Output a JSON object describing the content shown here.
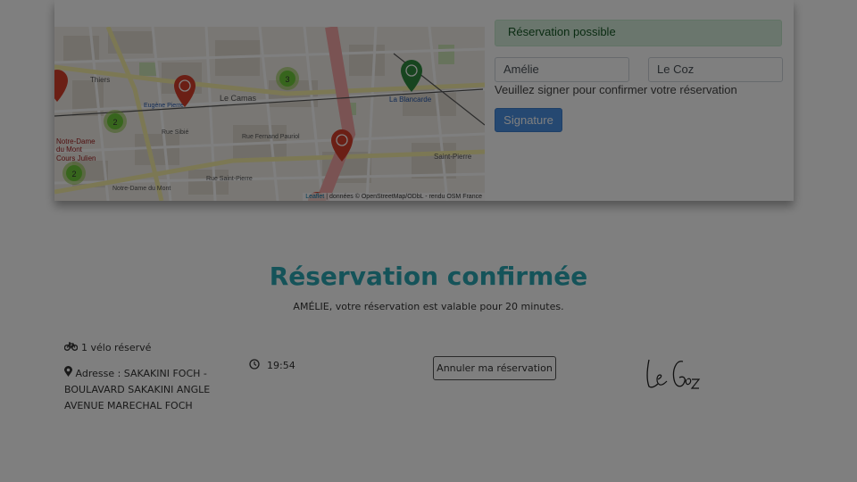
{
  "map": {
    "attribution_link": "Leaflet",
    "attribution_text": "| données © OpenStreetMap/ODbL - rendu OSM France",
    "cluster_counts": [
      "3",
      "2",
      "2"
    ],
    "street_labels": [
      "Le Camas",
      "La Blancarde",
      "Saint-Pierre",
      "Notre-Dame du Mont",
      "Cours Julien",
      "Thiers",
      "Eugène Pierre",
      "Rue Sibié",
      "Rue Fernand Pauriol",
      "Rue Saint-Pierre"
    ]
  },
  "form": {
    "alert_text": "Réservation possible",
    "first_name_value": "Amélie",
    "last_name_value": "Le Coz",
    "help_text": "Veuillez signer pour confirmer votre réservation",
    "signature_button": "Signature"
  },
  "confirmation": {
    "title": "Réservation confirmée",
    "subtitle": "AMÉLIE, votre réservation est valable pour 20 minutes.",
    "bikes_text": "1 vélo réservé",
    "address_text": "Adresse : SAKAKINI FOCH - BOULAVARD SAKAKINI ANGLE AVENUE MARECHAL FOCH",
    "time_text": "19:54",
    "cancel_button": "Annuler ma réservation",
    "signature_name": "Le Coz"
  },
  "colors": {
    "title_accent": "#2aa6b3",
    "primary_button": "#4a90e2",
    "marker_red": "#d63e2a",
    "marker_green": "#2e8b3e",
    "cluster_green": "#8cc63f"
  },
  "icons": [
    "bicycle-icon",
    "map-marker-icon",
    "clock-icon"
  ]
}
